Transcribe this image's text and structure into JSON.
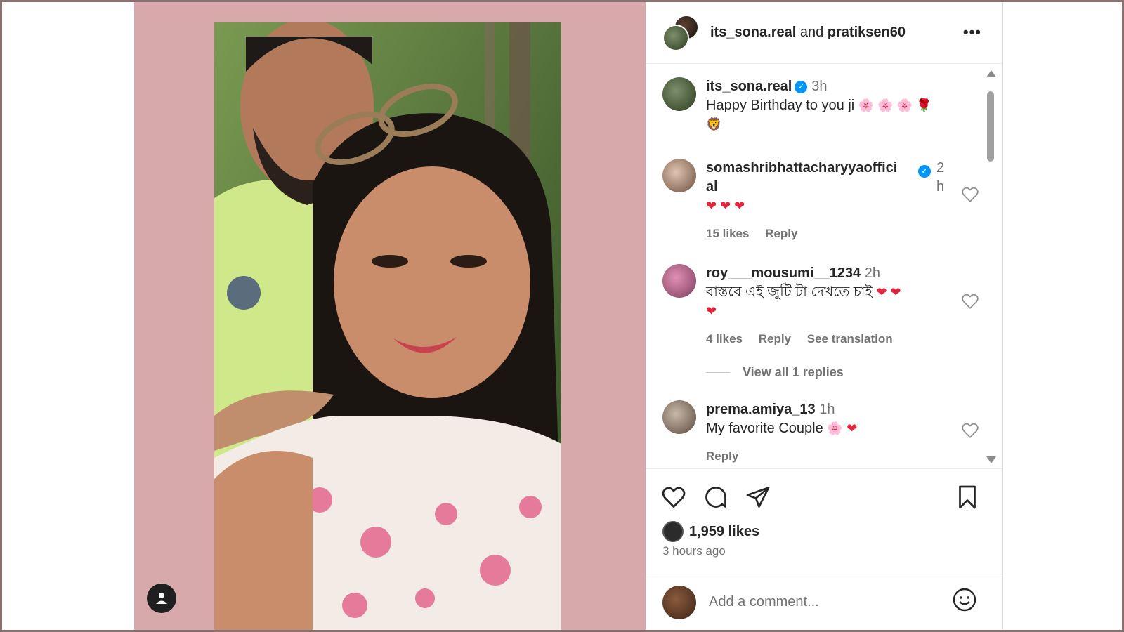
{
  "header": {
    "user1": "its_sona.real",
    "joiner": "and",
    "user2": "pratiksen60",
    "more_icon": "more-horizontal-icon"
  },
  "caption": {
    "username": "its_sona.real",
    "time": "3h",
    "text": "Happy Birthday to you ji",
    "emojis": "🌸 🌸 🌸 🌹",
    "emojis2": "🦁"
  },
  "comments": [
    {
      "username_line1": "somashribhattacharyyaoffici",
      "username_line2": "al",
      "time_line1": "2",
      "time_line2": "h",
      "text": "❤ ❤ ❤",
      "likes": "15 likes",
      "reply": "Reply"
    },
    {
      "username": "roy___mousumi__1234",
      "time": "2h",
      "text": "বাস্তবে এই জুটি টা দেখতে চাই",
      "emojis": "❤ ❤",
      "emojis2": "❤",
      "likes": "4 likes",
      "reply": "Reply",
      "translate": "See translation",
      "view_replies": "View all 1 replies"
    },
    {
      "username": "prema.amiya_13",
      "time": "1h",
      "text": "My favorite Couple",
      "emoji_flower": "🌸",
      "emoji_heart": "❤",
      "reply": "Reply"
    }
  ],
  "footer": {
    "likes": "1,959 likes",
    "posted": "3 hours ago",
    "comment_placeholder": "Add a comment..."
  },
  "colors": {
    "media_bg": "#d8a9aa",
    "verified": "#0095f6",
    "muted": "#737373",
    "text": "#262626"
  }
}
